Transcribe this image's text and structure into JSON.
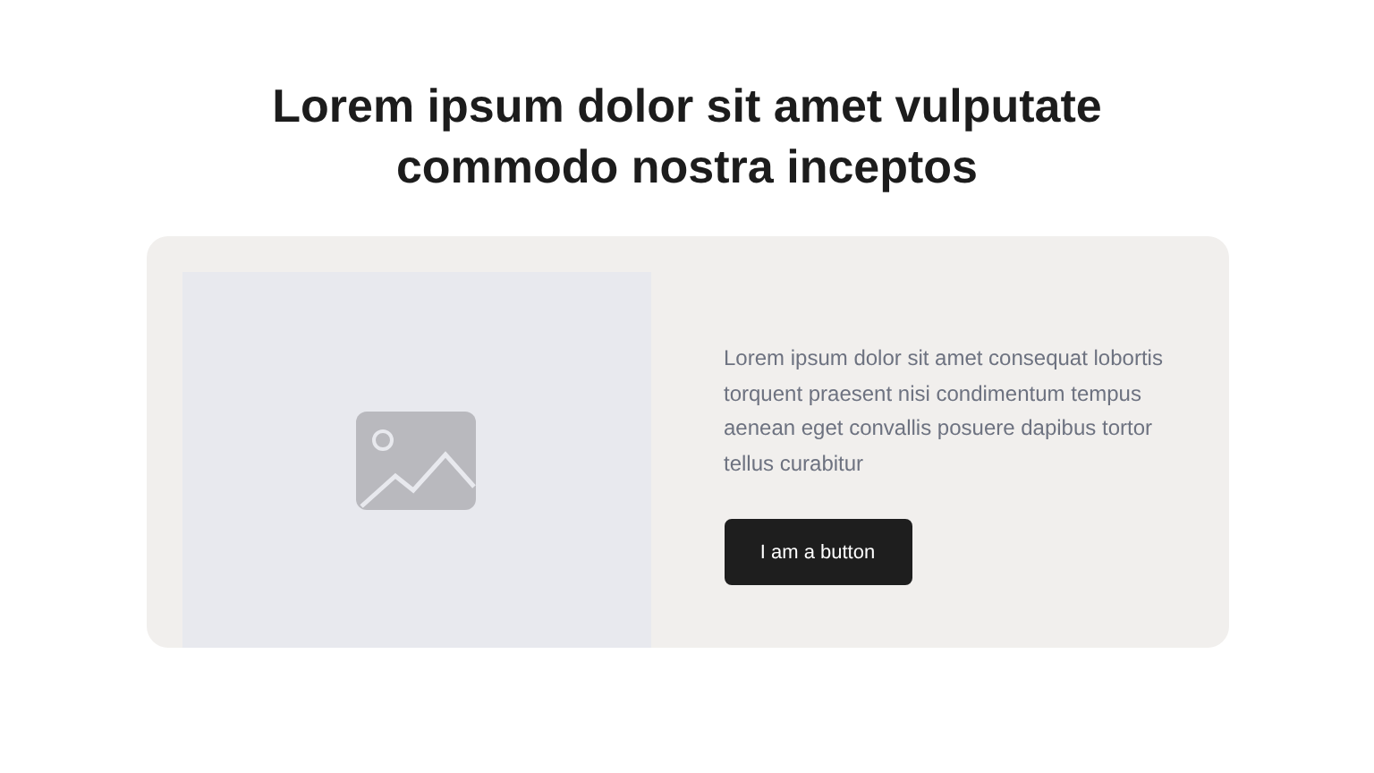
{
  "heading": "Lorem ipsum dolor sit amet vulputate commodo nostra inceptos",
  "card": {
    "media": {
      "kind": "placeholder"
    },
    "text": "Lorem ipsum dolor sit amet consequat lobortis torquent praesent nisi condimentum tempus aenean eget convallis posuere dapibus tortor tellus curabitur",
    "button": "I am a button"
  }
}
